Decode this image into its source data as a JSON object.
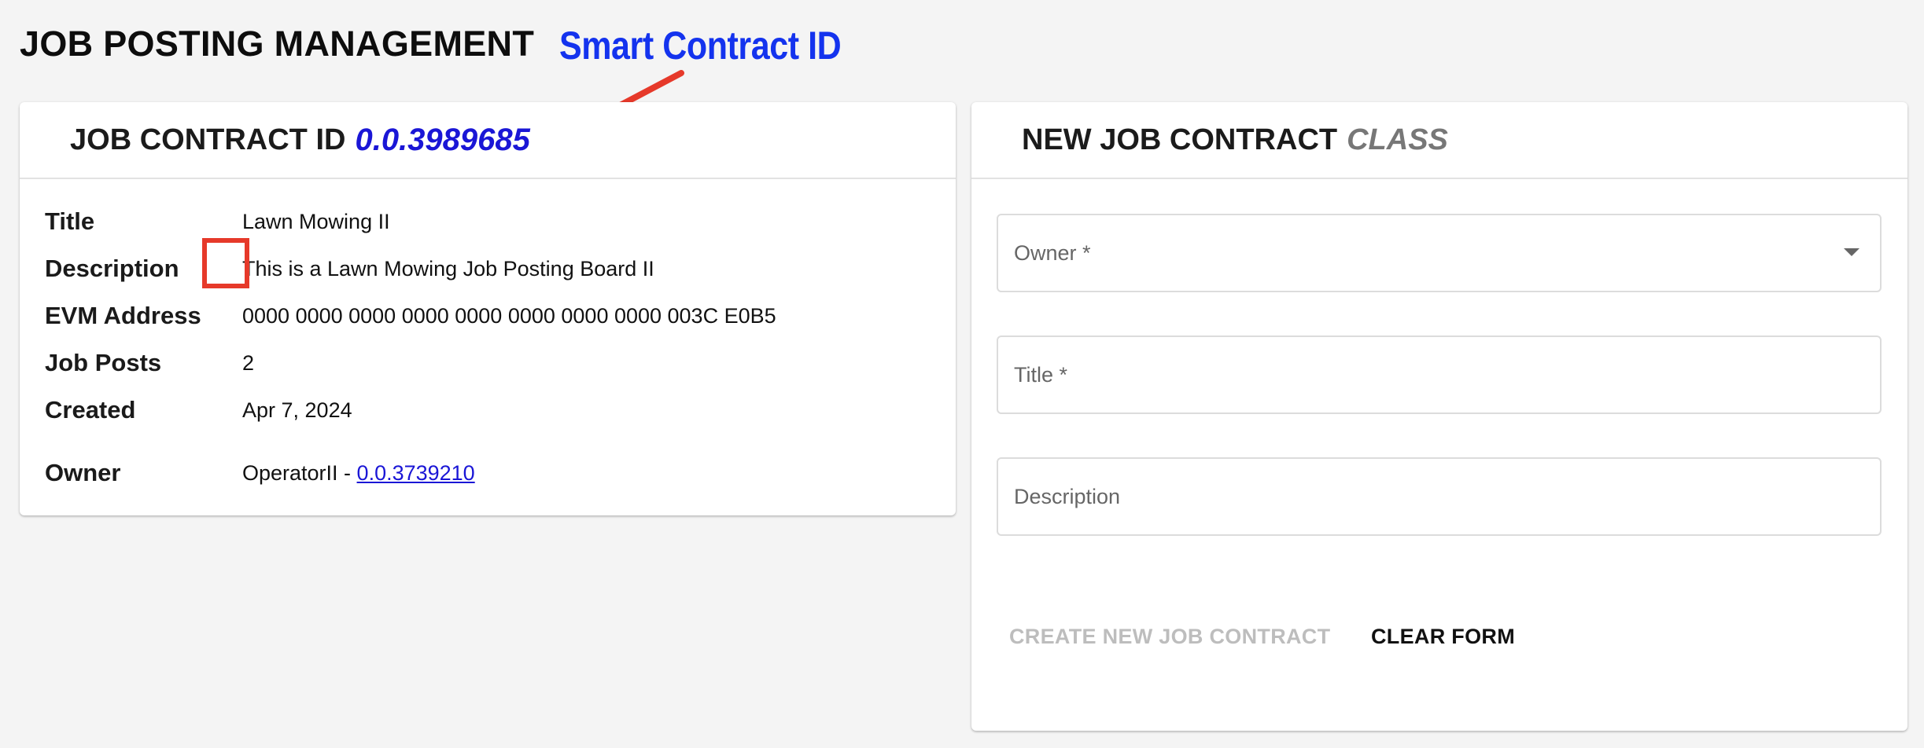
{
  "page": {
    "title": "JOB POSTING MANAGEMENT",
    "annotation": "Smart Contract ID"
  },
  "contract_card": {
    "header_prefix": "JOB CONTRACT ID",
    "contract_id": "0.0.3989685",
    "rows": [
      {
        "label": "Title",
        "value": "Lawn Mowing II"
      },
      {
        "label": "Description",
        "value": "This is a Lawn Mowing Job Posting Board II"
      },
      {
        "label": "EVM Address",
        "value": "0000 0000 0000 0000 0000 0000 0000 0000 003C E0B5"
      },
      {
        "label": "Job Posts",
        "value": "2"
      },
      {
        "label": "Created",
        "value": "Apr 7, 2024"
      }
    ],
    "owner": {
      "label": "Owner",
      "name": "OperatorII - ",
      "account_id": "0.0.3739210"
    }
  },
  "new_contract_card": {
    "header_prefix": "NEW JOB CONTRACT",
    "header_suffix": "CLASS",
    "fields": {
      "owner_placeholder": "Owner *",
      "title_placeholder": "Title *",
      "description_placeholder": "Description"
    },
    "buttons": {
      "create": "CREATE NEW JOB CONTRACT",
      "clear": "CLEAR FORM"
    }
  },
  "colors": {
    "accent_blue": "#1a16d6",
    "annotation_red": "#e6392a",
    "annotation_blue": "#1433ee"
  }
}
